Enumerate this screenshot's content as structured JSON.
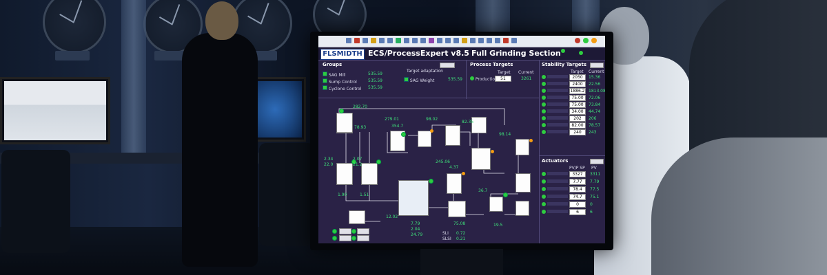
{
  "app": {
    "logo": "FLSMIDTH",
    "title": "ECS/ProcessExpert v8.5",
    "section": "Full Grinding Section"
  },
  "groups": {
    "title": "Groups",
    "items": [
      {
        "label": "SAG Mill",
        "value": "535.59"
      },
      {
        "label": "Sump Control",
        "value": "535.59"
      },
      {
        "label": "Cyclone Control",
        "value": "535.59"
      }
    ],
    "target_adaptation": "Target adaptation",
    "sag_weight_label": "SAG Weight",
    "sag_weight_value": "535.59"
  },
  "process_targets": {
    "title": "Process Targets",
    "col_target": "Target",
    "col_current": "Current",
    "production_label": "Production",
    "production_target": "51",
    "production_current": "3261"
  },
  "stability_targets": {
    "title": "Stability Targets",
    "col_target": "Target",
    "col_current": "Current",
    "rows": [
      {
        "target": "2050",
        "current": "15.36"
      },
      {
        "target": "2400",
        "current": "22.56"
      },
      {
        "target": "1886.2",
        "current": "1813.08"
      },
      {
        "target": "75.00",
        "current": "72.06"
      },
      {
        "target": "75.00",
        "current": "73.84"
      },
      {
        "target": "34.00",
        "current": "44.74"
      },
      {
        "target": "202",
        "current": "206"
      },
      {
        "target": "82.00",
        "current": "78.57"
      },
      {
        "target": "240",
        "current": "243"
      }
    ]
  },
  "actuators": {
    "title": "Actuators",
    "col_pvsp": "PV/P SP",
    "col_pv": "PV",
    "rows": [
      {
        "sp": "3327",
        "pv": "3311"
      },
      {
        "sp": "7.77",
        "pv": "7.79"
      },
      {
        "sp": "78.4",
        "pv": "77.5"
      },
      {
        "sp": "74.7",
        "pv": "75.1"
      },
      {
        "sp": "0",
        "pv": "0"
      },
      {
        "sp": "6",
        "pv": "6"
      }
    ]
  },
  "diagram": {
    "values": [
      "282.70",
      "78.93",
      "279.01",
      "354.7",
      "98.02",
      "82.35",
      "98.14",
      "2.34",
      "22.0",
      "2.07",
      "21.2",
      "245.06",
      "4.37",
      "36.7",
      "1.90",
      "1.51",
      "12.02",
      "75.08",
      "19.5",
      "7.79",
      "2.04",
      "24.79",
      "0.72",
      "0.21"
    ],
    "sli_label": "SLI",
    "slsi_label": "SLSI"
  },
  "colors": {
    "screen_bg": "#2a2246",
    "accent_green": "#3ee07a",
    "header_bg": "#1d1936"
  }
}
